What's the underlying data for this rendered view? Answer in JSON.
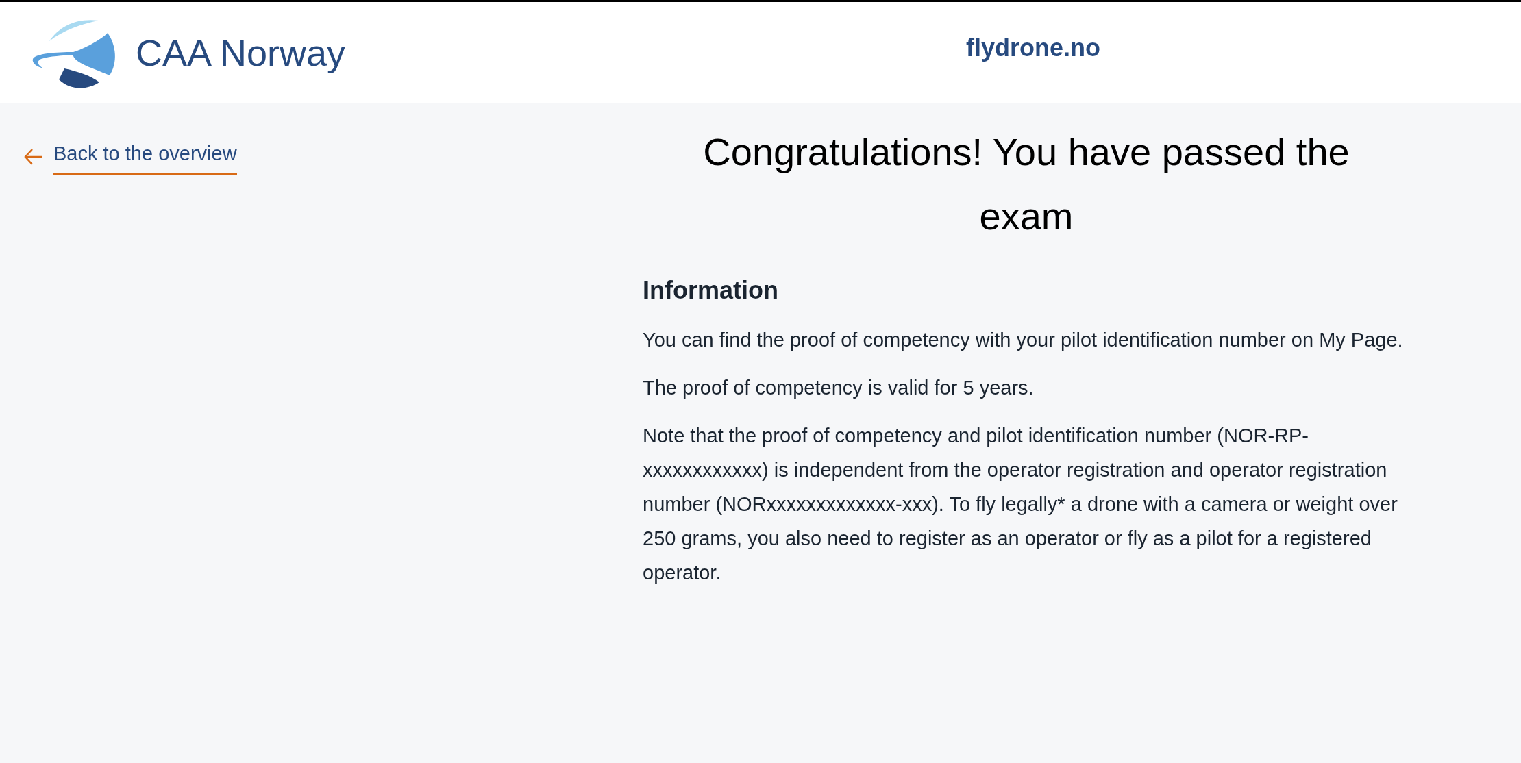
{
  "header": {
    "logo_text": "CAA Norway",
    "site_name": "flydrone.no"
  },
  "back_link": {
    "label": "Back to the overview"
  },
  "heading": "Congratulations! You have passed the exam",
  "section": {
    "title": "Information",
    "paragraphs": [
      "You can find the proof of competency with your pilot identification number on My Page.",
      "The proof of competency is valid for 5 years.",
      "Note that the proof of competency and pilot identification number (NOR-RP-xxxxxxxxxxxx) is independent from the operator registration and operator registration number (NORxxxxxxxxxxxxx-xxx). To fly legally* a drone with a camera or weight over 250 grams, you also need to register as an operator or fly as a pilot for a registered operator."
    ]
  }
}
